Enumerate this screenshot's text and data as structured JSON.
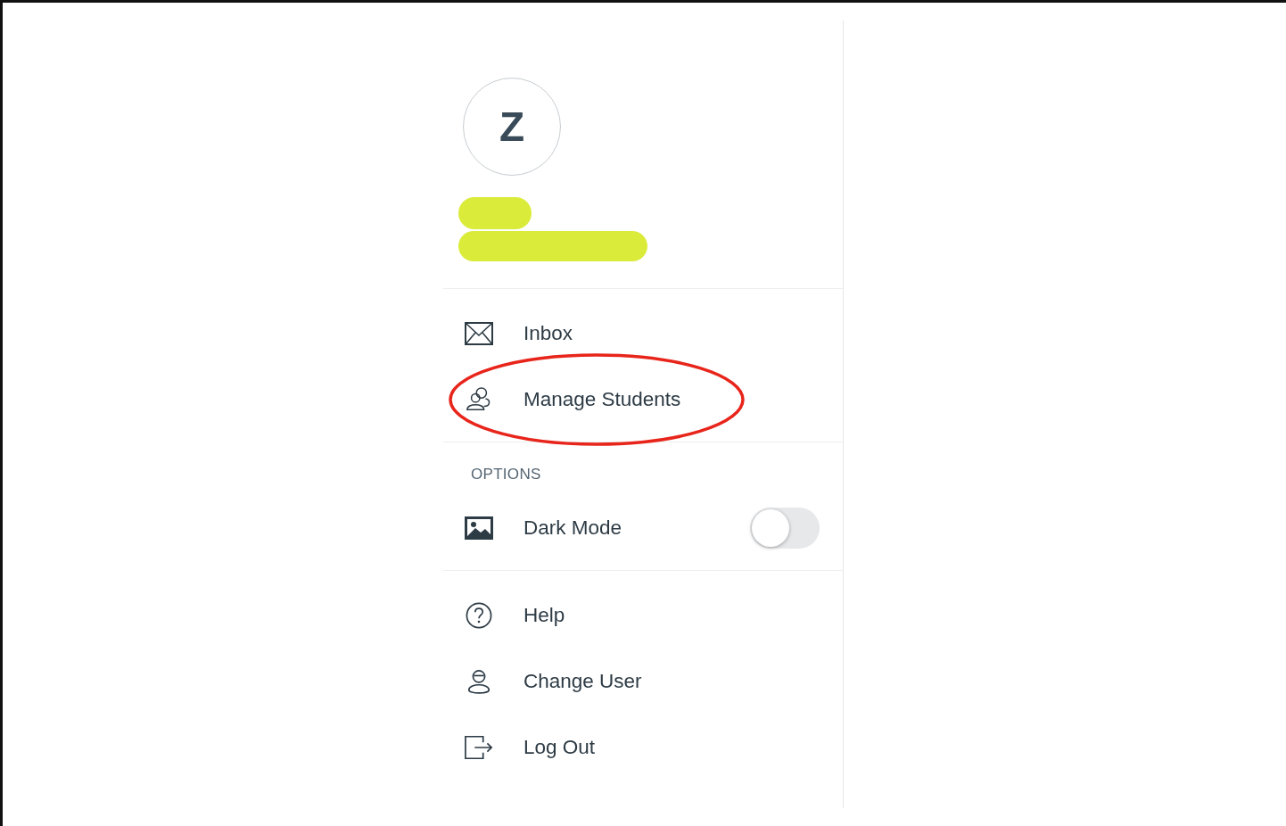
{
  "profile": {
    "initial": "Z",
    "redacted": true
  },
  "sections": [
    {
      "items": [
        {
          "kind": "link",
          "label": "Inbox",
          "highlighted": false
        },
        {
          "kind": "link",
          "label": "Manage Students",
          "highlighted": true
        }
      ]
    },
    {
      "title": "OPTIONS",
      "items": [
        {
          "kind": "toggle",
          "label": "Dark Mode",
          "on": false,
          "highlighted": false
        }
      ]
    },
    {
      "items": [
        {
          "kind": "link",
          "label": "Help",
          "highlighted": false
        },
        {
          "kind": "link",
          "label": "Change User",
          "highlighted": false
        },
        {
          "kind": "link",
          "label": "Log Out",
          "highlighted": false
        }
      ]
    }
  ]
}
